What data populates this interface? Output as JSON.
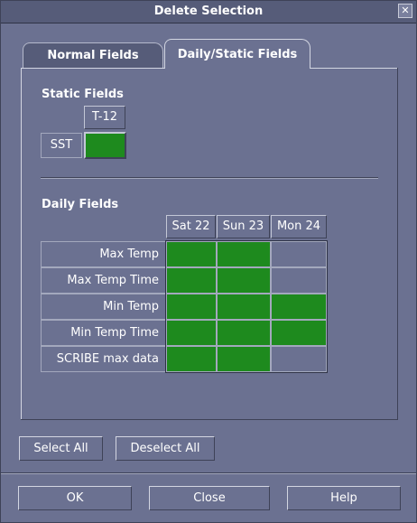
{
  "window": {
    "title": "Delete Selection",
    "close_glyph": "✕"
  },
  "tabs": [
    {
      "label": "Normal Fields",
      "active": false
    },
    {
      "label": "Daily/Static Fields",
      "active": true
    }
  ],
  "static_section": {
    "label": "Static Fields",
    "column": "T-12",
    "row": {
      "label": "SST",
      "selected": [
        true
      ]
    }
  },
  "daily_section": {
    "label": "Daily Fields",
    "columns": [
      "Sat 22",
      "Sun 23",
      "Mon 24"
    ],
    "rows": [
      {
        "label": "Max Temp",
        "selected": [
          true,
          true,
          false
        ]
      },
      {
        "label": "Max Temp Time",
        "selected": [
          true,
          true,
          false
        ]
      },
      {
        "label": "Min Temp",
        "selected": [
          true,
          true,
          true
        ]
      },
      {
        "label": "Min Temp Time",
        "selected": [
          true,
          true,
          true
        ]
      },
      {
        "label": "SCRIBE max data",
        "selected": [
          true,
          true,
          false
        ]
      }
    ]
  },
  "selection_buttons": {
    "select_all": "Select All",
    "deselect_all": "Deselect All"
  },
  "footer_buttons": {
    "ok": "OK",
    "close": "Close",
    "help": "Help"
  },
  "colors": {
    "selected": "#1e8a1e",
    "background": "#6b7191",
    "title_bar": "#565c79"
  }
}
